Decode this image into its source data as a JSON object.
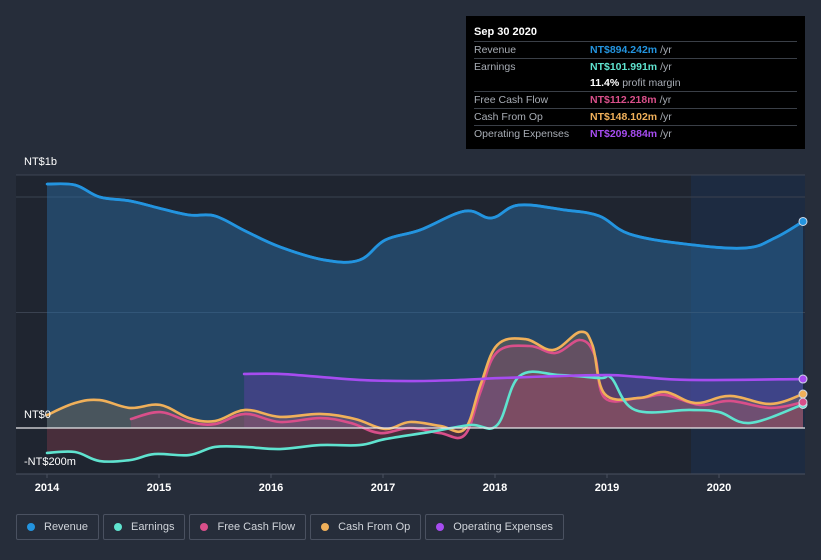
{
  "tooltip": {
    "date": "Sep 30 2020",
    "rows": [
      {
        "label": "Revenue",
        "value": "NT$894.242m",
        "unit": "/yr",
        "color": "#2394df"
      },
      {
        "label": "Earnings",
        "value": "NT$101.991m",
        "unit": "/yr",
        "color": "#5fe3cf"
      },
      {
        "label": "",
        "value": "11.4%",
        "unit": "profit margin",
        "color": "#ffffff"
      },
      {
        "label": "Free Cash Flow",
        "value": "NT$112.218m",
        "unit": "/yr",
        "color": "#d94f8a"
      },
      {
        "label": "Cash From Op",
        "value": "NT$148.102m",
        "unit": "/yr",
        "color": "#f0b05a"
      },
      {
        "label": "Operating Expenses",
        "value": "NT$209.884m",
        "unit": "/yr",
        "color": "#a64cf0"
      }
    ]
  },
  "legend": [
    {
      "label": "Revenue",
      "color": "#2394df"
    },
    {
      "label": "Earnings",
      "color": "#5fe3cf"
    },
    {
      "label": "Free Cash Flow",
      "color": "#d94f8a"
    },
    {
      "label": "Cash From Op",
      "color": "#f0b05a"
    },
    {
      "label": "Operating Expenses",
      "color": "#a64cf0"
    }
  ],
  "chart_data": {
    "type": "line",
    "title": "",
    "xlabel": "",
    "ylabel": "",
    "y_tick_labels": [
      {
        "value": 1000,
        "label": "NT$1b"
      },
      {
        "value": 0,
        "label": "NT$0"
      },
      {
        "value": -200,
        "label": "-NT$200m"
      }
    ],
    "x_tick_labels": [
      "2014",
      "2015",
      "2016",
      "2017",
      "2018",
      "2019",
      "2020"
    ],
    "x_ticks": [
      2014,
      2015,
      2016,
      2017,
      2018,
      2019,
      2020
    ],
    "xlim": [
      2013.7,
      2020.76
    ],
    "ylim": [
      -200,
      1095
    ],
    "gridlines_y": [
      1000,
      500
    ],
    "grid": true,
    "forecast_shade_start": 2019.75,
    "legend_position": "bottom",
    "units": "NT$ millions per year",
    "series": [
      {
        "name": "Revenue",
        "color": "#2394df",
        "x": [
          2014.0,
          2014.25,
          2014.47,
          2014.74,
          2015.0,
          2015.27,
          2015.5,
          2015.77,
          2016.08,
          2016.48,
          2016.79,
          2017.02,
          2017.33,
          2017.73,
          2017.97,
          2018.21,
          2018.62,
          2018.93,
          2019.2,
          2019.69,
          2020.23,
          2020.5,
          2020.75
        ],
        "values": [
          1056,
          1052,
          1000,
          983,
          952,
          922,
          918,
          853,
          784,
          727,
          727,
          814,
          857,
          939,
          909,
          965,
          944,
          918,
          840,
          797,
          779,
          823,
          894
        ]
      },
      {
        "name": "Earnings",
        "color": "#5fe3cf",
        "x": [
          2014.0,
          2014.25,
          2014.47,
          2014.74,
          2014.96,
          2015.27,
          2015.5,
          2015.77,
          2016.08,
          2016.44,
          2016.79,
          2017.02,
          2017.42,
          2017.78,
          2018.02,
          2018.22,
          2018.58,
          2018.94,
          2019.04,
          2019.25,
          2019.74,
          2020.0,
          2020.28,
          2020.75
        ],
        "values": [
          -108,
          -104,
          -143,
          -139,
          -113,
          -117,
          -82,
          -82,
          -91,
          -74,
          -74,
          -48,
          -17,
          13,
          13,
          225,
          229,
          216,
          216,
          78,
          78,
          69,
          22,
          102
        ]
      },
      {
        "name": "Free Cash Flow",
        "color": "#d94f8a",
        "x": [
          2014.75,
          2015.01,
          2015.28,
          2015.5,
          2015.77,
          2016.08,
          2016.44,
          2016.71,
          2016.97,
          2017.24,
          2017.51,
          2017.73,
          2017.87,
          2018.02,
          2018.31,
          2018.54,
          2018.76,
          2018.89,
          2018.98,
          2019.29,
          2019.52,
          2019.83,
          2020.1,
          2020.46,
          2020.75
        ],
        "values": [
          39,
          69,
          26,
          17,
          61,
          26,
          43,
          22,
          -22,
          0,
          -22,
          -30,
          156,
          329,
          355,
          325,
          381,
          316,
          130,
          130,
          143,
          100,
          117,
          87,
          112
        ]
      },
      {
        "name": "Cash From Op",
        "color": "#f0b05a",
        "x": [
          2014.0,
          2014.25,
          2014.47,
          2014.74,
          2015.01,
          2015.27,
          2015.5,
          2015.77,
          2016.08,
          2016.44,
          2016.75,
          2017.02,
          2017.24,
          2017.51,
          2017.73,
          2017.87,
          2018.02,
          2018.27,
          2018.52,
          2018.76,
          2018.87,
          2018.98,
          2019.29,
          2019.52,
          2019.79,
          2020.1,
          2020.46,
          2020.75
        ],
        "values": [
          56,
          108,
          121,
          87,
          100,
          43,
          30,
          78,
          48,
          61,
          39,
          -4,
          26,
          9,
          -4,
          186,
          359,
          385,
          338,
          416,
          359,
          147,
          130,
          156,
          108,
          139,
          104,
          147
        ]
      },
      {
        "name": "Operating Expenses",
        "color": "#a64cf0",
        "x": [
          2015.76,
          2016.08,
          2016.44,
          2016.79,
          2017.24,
          2017.69,
          2018.04,
          2018.58,
          2019.02,
          2019.29,
          2019.74,
          2020.75
        ],
        "values": [
          234,
          234,
          221,
          208,
          203,
          208,
          216,
          225,
          229,
          221,
          208,
          212
        ]
      }
    ]
  }
}
